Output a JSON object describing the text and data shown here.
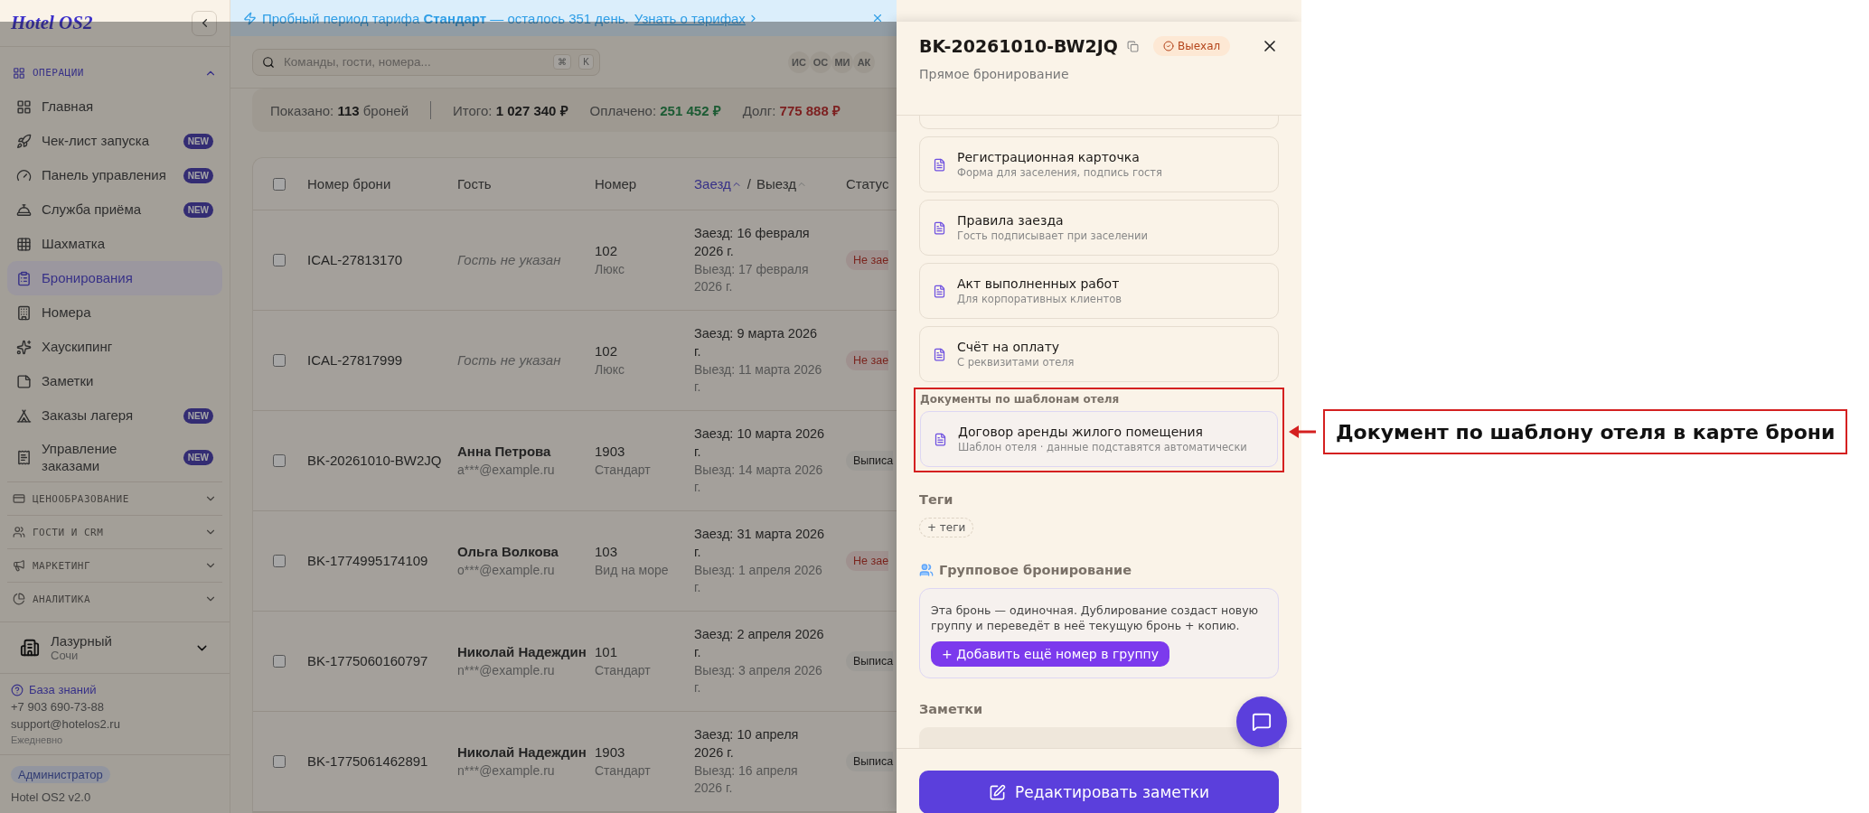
{
  "banner": {
    "text": "Пробный период тарифа **Стандарт** — осталось 351 день.",
    "link": "Узнать о тарифах"
  },
  "sidebar": {
    "logo": "Hotel OS2",
    "sections": [
      {
        "label": "ОПЕРАЦИИ",
        "expanded": true,
        "items": [
          {
            "label": "Главная",
            "selected": false
          },
          {
            "label": "Чек-лист запуска",
            "badge": "NEW",
            "selected": false
          },
          {
            "label": "Панель управления",
            "badge": "NEW",
            "selected": false
          },
          {
            "label": "Служба приёма",
            "badge": "NEW",
            "selected": false
          },
          {
            "label": "Шахматка",
            "selected": false
          },
          {
            "label": "Бронирования",
            "selected": true
          },
          {
            "label": "Номера",
            "selected": false
          },
          {
            "label": "Хаускипинг",
            "selected": false
          },
          {
            "label": "Заметки",
            "selected": false
          },
          {
            "label": "Заказы лагеря",
            "badge": "NEW",
            "selected": false
          },
          {
            "label": "Управление заказами",
            "badge": "NEW",
            "selected": false
          }
        ]
      },
      {
        "label": "ЦЕНООБРАЗОВАНИЕ",
        "expanded": false
      },
      {
        "label": "ГОСТИ И CRM",
        "expanded": false
      },
      {
        "label": "МАРКЕТИНГ",
        "expanded": false
      },
      {
        "label": "АНАЛИТИКА",
        "expanded": false
      }
    ],
    "hotel": {
      "name": "Лазурный",
      "city": "Сочи"
    },
    "help": {
      "link": "База знаний",
      "phone": "+7 903 690-73-88",
      "email": "support@hotelos2.ru",
      "hours": "Ежедневно"
    },
    "role": "Администратор",
    "version": "Hotel OS2 v2.0"
  },
  "header": {
    "search": {
      "placeholder": "Команды, гости, номера...",
      "keys": [
        "⌘",
        "K"
      ]
    },
    "avatars": [
      "ИС",
      "ОС",
      "МИ",
      "АК"
    ]
  },
  "summary": [
    {
      "label": "Показано:",
      "value": "113",
      "suffix": "броней",
      "kind": "plain"
    },
    {
      "label": "Итого:",
      "value": "1 027 340 ₽",
      "kind": "plain"
    },
    {
      "label": "Оплачено:",
      "value": "251 452 ₽",
      "kind": "paid"
    },
    {
      "label": "Долг:",
      "value": "775 888 ₽",
      "kind": "debt"
    }
  ],
  "table": {
    "select_all": {
      "checked": false
    },
    "columns": [
      {
        "kind": "text",
        "label": "Номер брони"
      },
      {
        "kind": "text",
        "label": "Гость"
      },
      {
        "kind": "text",
        "label": "Номер"
      },
      {
        "kind": "dates",
        "checkin": "Заезд",
        "separator": "/",
        "checkout": "Выезд",
        "sorted": true
      },
      {
        "kind": "text",
        "label": "Статус"
      }
    ],
    "rows": [
      {
        "checked": false,
        "id": "ICAL-27813170",
        "guest": "Гость не указан",
        "guest_known": false,
        "room": "102",
        "room_type": "Люкс",
        "checkin": "Заезд: 16 февраля 2026 г.",
        "checkout": "Выезд: 17 февраля 2026 г.",
        "status": "Не зае",
        "kind": "pending"
      },
      {
        "checked": false,
        "id": "ICAL-27817999",
        "guest": "Гость не указан",
        "guest_known": false,
        "room": "102",
        "room_type": "Люкс",
        "checkin": "Заезд: 9 марта 2026 г.",
        "checkout": "Выезд: 11 марта 2026 г.",
        "status": "Не зае",
        "kind": "pending"
      },
      {
        "checked": false,
        "id": "BK-20261010-BW2JQ",
        "guest": "Анна Петрова",
        "guest_known": true,
        "email": "a***@example.ru",
        "room": "1903",
        "room_type": "Стандарт",
        "checkin": "Заезд: 10 марта 2026 г.",
        "checkout": "Выезд: 14 марта 2026 г.",
        "status": "Выписа",
        "kind": "done"
      },
      {
        "checked": false,
        "id": "BK-1774995174109",
        "guest": "Ольга Волкова",
        "guest_known": true,
        "email": "o***@example.ru",
        "room": "103",
        "room_type": "Вид на море",
        "checkin": "Заезд: 31 марта 2026 г.",
        "checkout": "Выезд: 1 апреля 2026 г.",
        "status": "Не зае",
        "kind": "pending"
      },
      {
        "checked": false,
        "id": "BK-1775060160797",
        "guest": "Николай Надеждин",
        "guest_known": true,
        "email": "n***@example.ru",
        "room": "101",
        "room_type": "Стандарт",
        "checkin": "Заезд: 2 апреля 2026 г.",
        "checkout": "Выезд: 3 апреля 2026 г.",
        "status": "Выписа",
        "kind": "done"
      },
      {
        "checked": false,
        "id": "BK-1775061462891",
        "guest": "Николай Надеждин",
        "guest_known": true,
        "email": "n***@example.ru",
        "room": "1903",
        "room_type": "Стандарт",
        "checkin": "Заезд: 10 апреля 2026 г.",
        "checkout": "Выезд: 16 апреля 2026 г.",
        "status": "Выписа",
        "kind": "done"
      }
    ]
  },
  "drawer": {
    "title": "BK-20261010-BW2JQ",
    "status": "Выехал",
    "subtitle": "Прямое бронирование",
    "documents": [
      {
        "title": "Регистрационная карточка",
        "subtitle": "Форма для заселения, подпись гостя"
      },
      {
        "title": "Правила заезда",
        "subtitle": "Гость подписывает при заселении"
      },
      {
        "title": "Акт выполненных работ",
        "subtitle": "Для корпоративных клиентов"
      },
      {
        "title": "Счёт на оплату",
        "subtitle": "С реквизитами отеля"
      }
    ],
    "template_section": {
      "heading": "Документы по шаблонам отеля",
      "highlighted": true,
      "documents": [
        {
          "title": "Договор аренды жилого помещения",
          "subtitle": "Шаблон отеля · данные подставятся автоматически"
        }
      ]
    },
    "tags": {
      "heading": "Теги",
      "add": "+ теги"
    },
    "group": {
      "heading": "Групповое бронирование",
      "text": "Эта бронь — одиночная. Дублирование создаст новую группу и переведёт в неё текущую бронь + копию.",
      "button": "+ Добавить ещё номер в группу"
    },
    "notes": {
      "heading": "Заметки"
    },
    "footer_button": "Редактировать заметки"
  },
  "callout": "Документ по шаблону отеля в карте брони"
}
